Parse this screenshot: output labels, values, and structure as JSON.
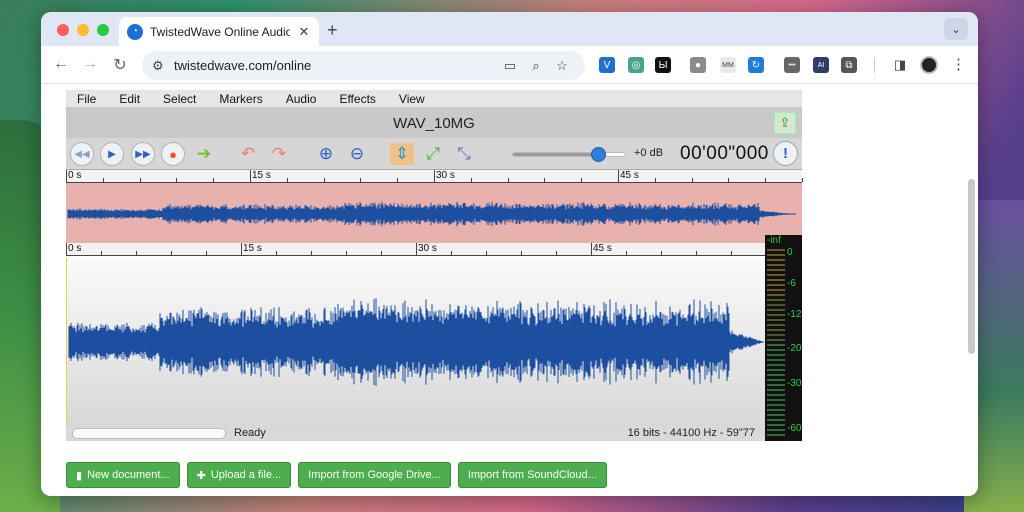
{
  "browser": {
    "tab_title": "TwistedWave Online Audio Ed",
    "tab_close": "✕",
    "new_tab": "+",
    "tab_menu": "⌄",
    "url": "twistedwave.com/online",
    "extensions": [
      {
        "icon": "vivaldi-ext-icon",
        "glyph": "V",
        "color": "#1f6fd1"
      },
      {
        "icon": "globe-ext-icon",
        "glyph": "◎",
        "color": "#49a48c"
      },
      {
        "icon": "dark-ext-icon",
        "glyph": "Ы",
        "color": "#111111"
      },
      {
        "icon": "world-ext-icon",
        "glyph": "●",
        "color": "#8a8a8a"
      },
      {
        "icon": "mmra-ext-icon",
        "glyph": "MM",
        "color": "#e9e9e9"
      },
      {
        "icon": "sync-ext-icon",
        "glyph": "↻",
        "color": "#1b7ed8"
      },
      {
        "icon": "dots-ext-icon",
        "glyph": "•••",
        "color": "#666666"
      },
      {
        "icon": "ai-ext-icon",
        "glyph": "AI",
        "color": "#2d3f66"
      },
      {
        "icon": "puzzle-ext-icon",
        "glyph": "⧉",
        "color": "#555555"
      }
    ]
  },
  "app": {
    "menu": [
      "File",
      "Edit",
      "Select",
      "Markers",
      "Audio",
      "Effects",
      "View"
    ],
    "document_title": "WAV_10MG",
    "volume_label": "+0 dB",
    "volume_level": 0.77,
    "timecode": "00'00\"000",
    "ruler_labels": [
      "0 s",
      "15 s",
      "30 s",
      "45 s"
    ],
    "status": "Ready",
    "format": "16 bits - 44100 Hz - 59\"77",
    "meter_labels": [
      "-inf",
      "0",
      "-6",
      "-12",
      "-20",
      "-30",
      "-60"
    ]
  },
  "actions": [
    {
      "label": "New document...",
      "icon": "document-icon"
    },
    {
      "label": "Upload a file...",
      "icon": "plus-icon"
    },
    {
      "label": "Import from Google Drive...",
      "icon": ""
    },
    {
      "label": "Import from SoundCloud...",
      "icon": ""
    }
  ],
  "colors": {
    "waveform": "#1c4fa0",
    "overview_bg": "#e8b1ad",
    "action_green": "#4cae4c",
    "meter_green": "#2ecc40"
  }
}
